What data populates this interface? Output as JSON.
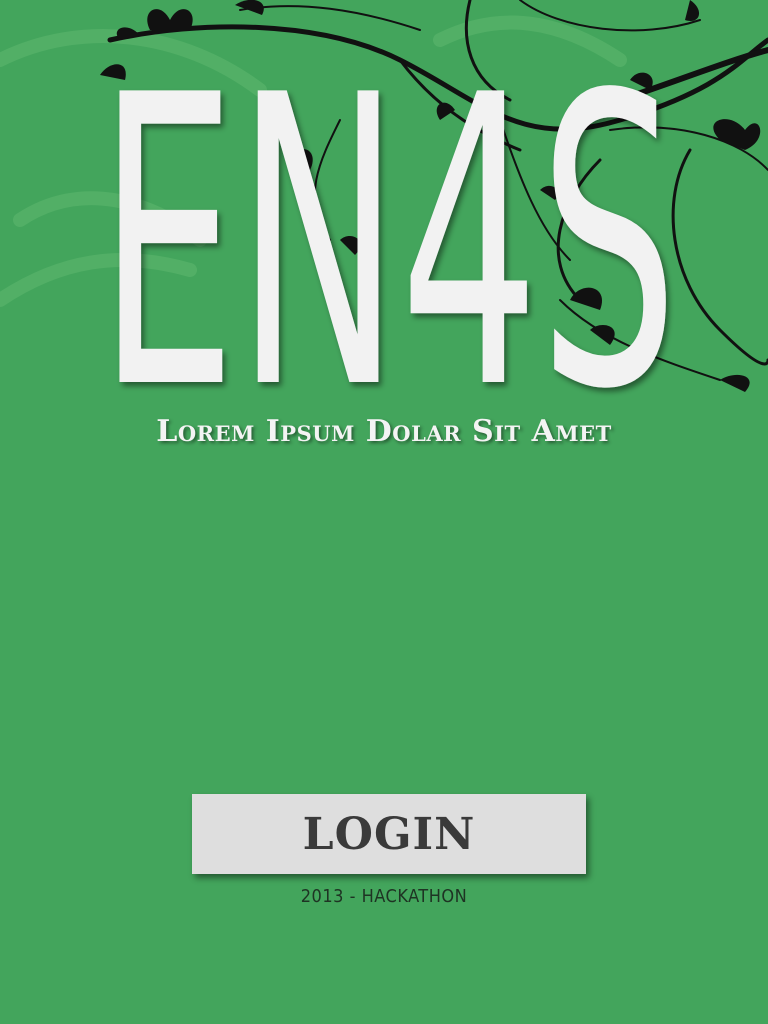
{
  "app": {
    "logo_text": "EN4S",
    "tagline": "Lorem Ipsum Dolar Sit Amet"
  },
  "login": {
    "button_label": "LOGIN"
  },
  "footer": {
    "text": "2013 - HACKATHON"
  },
  "colors": {
    "background": "#43a55c",
    "logo_text": "#f2f2f2",
    "button_bg": "#dedede",
    "button_text": "#3a3a3a",
    "floral": "#111111"
  },
  "decorations": {
    "background_art": "floral-swirl"
  }
}
